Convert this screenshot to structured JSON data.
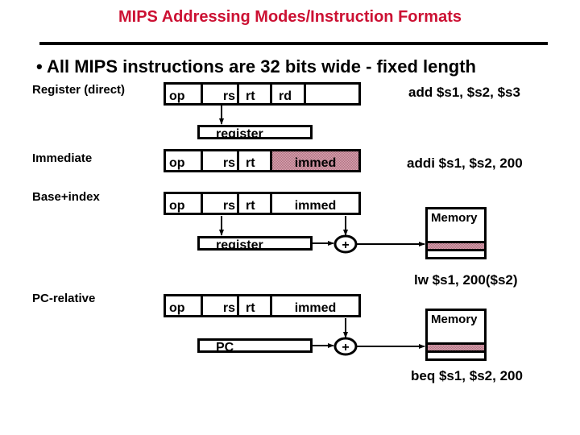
{
  "title": "MIPS Addressing Modes/Instruction Formats",
  "bullet": "• All MIPS instructions are 32 bits wide - fixed length",
  "colors": {
    "title": "#cc1133",
    "highlight": "#d9a6b3"
  },
  "modes": [
    {
      "name": "Register (direct)",
      "fields": [
        "op",
        "rs",
        "rt",
        "rd",
        ""
      ],
      "target": "register",
      "example": "add $s1, $s2, $s3"
    },
    {
      "name": "Immediate",
      "fields": [
        "op",
        "rs",
        "rt",
        "immed"
      ],
      "example": "addi $s1, $s2, 200"
    },
    {
      "name": "Base+index",
      "fields": [
        "op",
        "rs",
        "rt",
        "immed"
      ],
      "base": "register",
      "adder": "+",
      "memory": "Memory",
      "example": "lw  $s1, 200($s2)"
    },
    {
      "name": "PC-relative",
      "fields": [
        "op",
        "rs",
        "rt",
        "immed"
      ],
      "base": "PC",
      "adder": "+",
      "memory": "Memory",
      "example": "beq $s1, $s2, 200"
    }
  ]
}
